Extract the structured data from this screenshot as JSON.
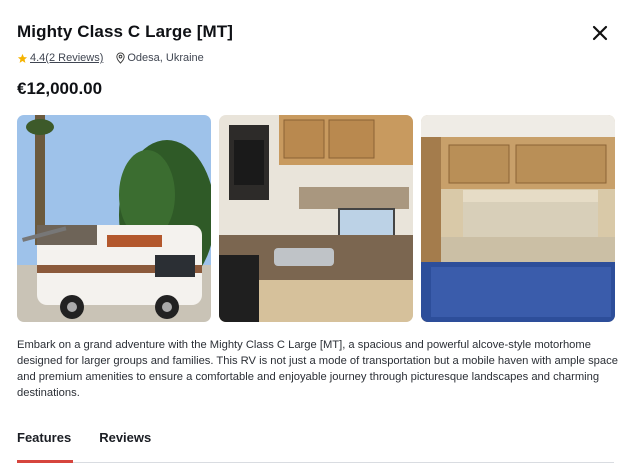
{
  "listing": {
    "title": "Mighty Class C Large [MT]",
    "rating_text": "4.4(2 Reviews)",
    "location": "Odesa, Ukraine",
    "price": "€12,000.00",
    "description": "Embark on a grand adventure with the Mighty Class C Large [MT], a spacious and powerful alcove-style motorhome designed for larger groups and families. This RV is not just a mode of transportation but a mobile haven with ample space and premium amenities to ensure a comfortable and enjoyable journey through picturesque landscapes and charming destinations."
  },
  "icons": {
    "close": "close-icon",
    "star": "star-icon",
    "location": "map-pin-icon"
  },
  "gallery": [
    {
      "name": "rv-exterior-photo"
    },
    {
      "name": "rv-kitchen-photo"
    },
    {
      "name": "rv-bed-photo"
    }
  ],
  "tabs": [
    {
      "label": "Features",
      "active": true
    },
    {
      "label": "Reviews",
      "active": false
    }
  ],
  "colors": {
    "accent": "#d6453d",
    "star": "#f5b301"
  }
}
